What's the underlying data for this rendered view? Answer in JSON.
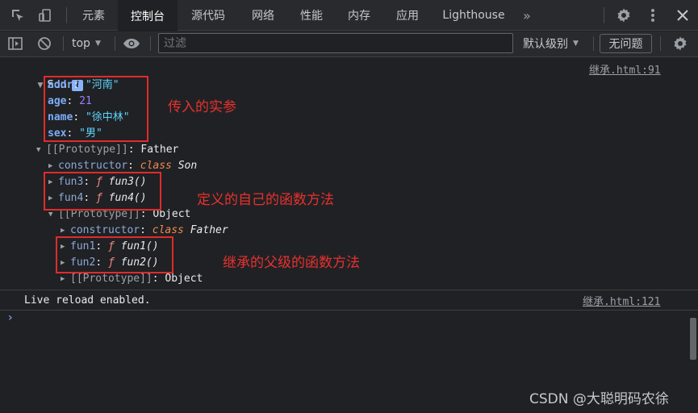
{
  "tabs": [
    {
      "label": "元素",
      "active": false
    },
    {
      "label": "控制台",
      "active": true
    },
    {
      "label": "源代码",
      "active": false
    },
    {
      "label": "网络",
      "active": false
    },
    {
      "label": "性能",
      "active": false
    },
    {
      "label": "内存",
      "active": false
    },
    {
      "label": "应用",
      "active": false
    },
    {
      "label": "Lighthouse",
      "active": false
    }
  ],
  "tab_overflow": "»",
  "toolbar": {
    "context": "top",
    "filter_placeholder": "过滤",
    "log_level": "默认级别",
    "issues_label": "无问题"
  },
  "icons": {
    "inspect": "inspect-element-icon",
    "device": "device-toggle-icon",
    "settings": "gear-icon",
    "menu": "kebab-menu-icon",
    "close": "close-icon",
    "sidebar": "sidebar-toggle-icon",
    "clear": "clear-console-icon",
    "eye": "live-expression-icon"
  },
  "console": {
    "object_name": "Son",
    "object_source": "继承.html:91",
    "props": [
      {
        "key": "addr",
        "value": "\"河南\""
      },
      {
        "key": "age",
        "value": "21"
      },
      {
        "key": "name",
        "value": "\"徐中林\""
      },
      {
        "key": "sex",
        "value": "\"男\""
      }
    ],
    "proto1_label": "[[Prototype]]",
    "proto1_value": "Father",
    "constructor_key": "constructor",
    "class_kw": "class",
    "son_class": "Son",
    "father_class": "Father",
    "own_methods": [
      {
        "key": "fun3",
        "fn": "ƒ",
        "name": "fun3()"
      },
      {
        "key": "fun4",
        "fn": "ƒ",
        "name": "fun4()"
      }
    ],
    "proto2_label": "[[Prototype]]",
    "proto2_value": "Object",
    "parent_methods": [
      {
        "key": "fun1",
        "fn": "ƒ",
        "name": "fun1()"
      },
      {
        "key": "fun2",
        "fn": "ƒ",
        "name": "fun2()"
      }
    ],
    "proto3_label": "[[Prototype]]",
    "proto3_value": "Object",
    "live_reload": "Live reload enabled.",
    "live_reload_source": "继承.html:121",
    "prompt": "›"
  },
  "annotations": {
    "note1": "传入的实参",
    "note2": "定义的自己的函数方法",
    "note3": "继承的父级的函数方法",
    "box_color": "#e02b2b"
  },
  "watermark": "CSDN @大聪明码农徐"
}
